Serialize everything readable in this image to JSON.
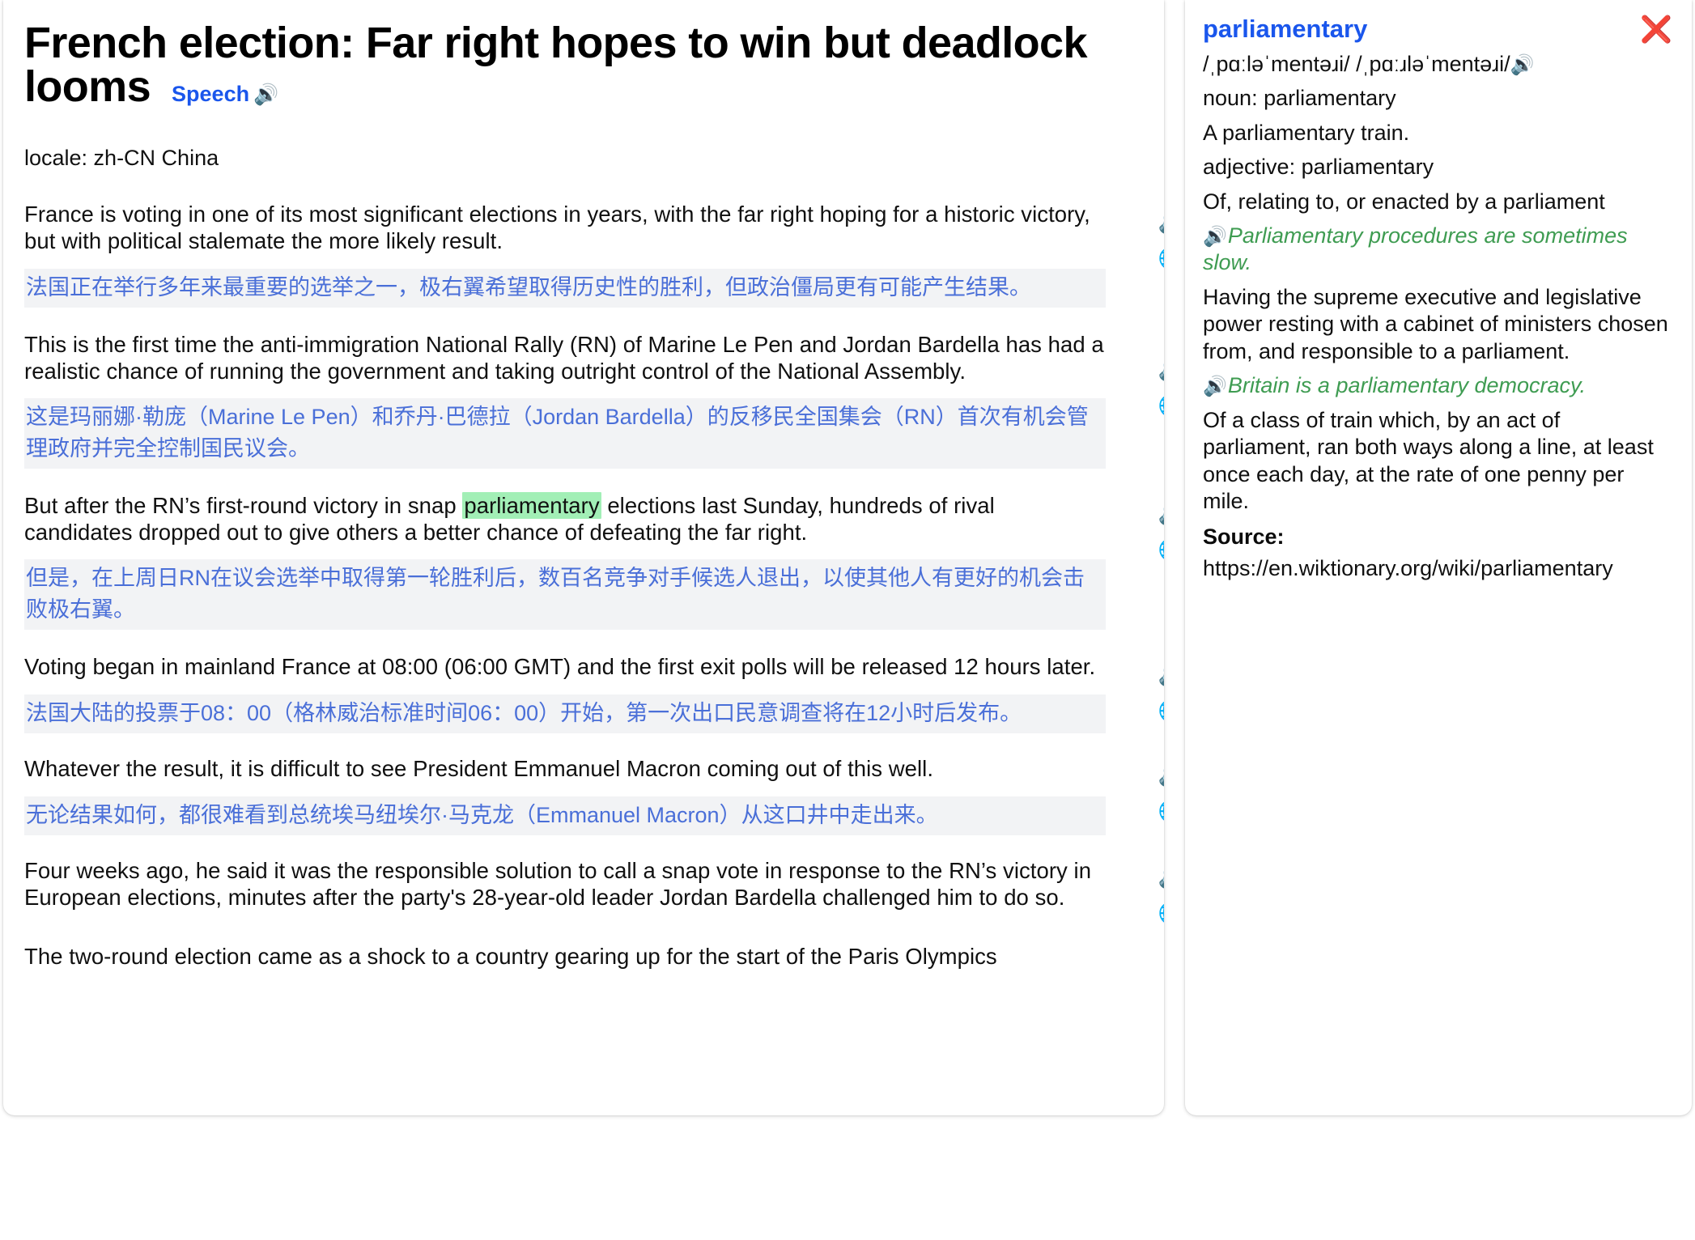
{
  "article": {
    "title": "French election: Far right hopes to win but deadlock looms",
    "speech_label": "Speech",
    "speech_icon": "speaker-icon",
    "locale_line": "locale: zh-CN China",
    "speaker_icon": "🔊",
    "globe_icon": "🌐",
    "highlight_word": "parliamentary",
    "highlight_color": "#a2efb6",
    "paragraphs": [
      {
        "en_before": "France is voting in one of its most significant elections in years, with the far right hoping for a historic victory, but with political stalemate the more likely result.",
        "en_highlight": "",
        "en_after": "",
        "zh": "法国正在举行多年来最重要的选举之一，极右翼希望取得历史性的胜利，但政治僵局更有可能产生结果。"
      },
      {
        "en_before": "This is the first time the anti-immigration National Rally (RN) of Marine Le Pen and Jordan Bardella has had a realistic chance of running the government and taking outright control of the National Assembly.",
        "en_highlight": "",
        "en_after": "",
        "zh": "这是玛丽娜·勒庞（Marine Le Pen）和乔丹·巴德拉（Jordan Bardella）的反移民全国集会（RN）首次有机会管理政府并完全控制国民议会。"
      },
      {
        "en_before": "But after the RN’s first-round victory in snap ",
        "en_highlight": "parliamentary",
        "en_after": " elections last Sunday, hundreds of rival candidates dropped out to give others a better chance of defeating the far right.",
        "zh": "但是，在上周日RN在议会选举中取得第一轮胜利后，数百名竞争对手候选人退出，以使其他人有更好的机会击败极右翼。"
      },
      {
        "en_before": "Voting began in mainland France at 08:00 (06:00 GMT) and the first exit polls will be released 12 hours later.",
        "en_highlight": "",
        "en_after": "",
        "zh": "法国大陆的投票于08：00（格林威治标准时间06：00）开始，第一次出口民意调查将在12小时后发布。"
      },
      {
        "en_before": "Whatever the result, it is difficult to see President Emmanuel Macron coming out of this well.",
        "en_highlight": "",
        "en_after": "",
        "zh": "无论结果如何，都很难看到总统埃马纽埃尔·马克龙（Emmanuel Macron）从这口井中走出来。"
      },
      {
        "en_before": "Four weeks ago, he said it was the responsible solution to call a snap vote in response to the RN’s victory in European elections, minutes after the party's 28-year-old leader Jordan Bardella challenged him to do so.",
        "en_highlight": "",
        "en_after": "",
        "zh": ""
      },
      {
        "en_before": "The two-round election came as a shock to a country gearing up for the start of the Paris Olympics",
        "en_highlight": "",
        "en_after": "",
        "zh": ""
      }
    ]
  },
  "dictionary": {
    "word": "parliamentary",
    "close_icon": "❌",
    "speaker_icon": "🔊",
    "ipa": "/ˌpɑːləˈmentəɹi/  /ˌpɑːɹləˈmentəɹi/",
    "entries": [
      {
        "type": "pos",
        "text": "noun: parliamentary"
      },
      {
        "type": "def",
        "text": "A parliamentary train."
      },
      {
        "type": "pos",
        "text": "adjective: parliamentary"
      },
      {
        "type": "def",
        "text": "Of, relating to, or enacted by a parliament"
      },
      {
        "type": "example",
        "text": "Parliamentary procedures are sometimes slow."
      },
      {
        "type": "def",
        "text": "Having the supreme executive and legislative power resting with a cabinet of ministers chosen from, and responsible to a parliament."
      },
      {
        "type": "example",
        "text": "Britain is a parliamentary democracy."
      },
      {
        "type": "def",
        "text": "Of a class of train which, by an act of parliament, ran both ways along a line, at least once each day, at the rate of one penny per mile."
      }
    ],
    "source_label": "Source:",
    "source_url": "https://en.wiktionary.org/wiki/parliamentary"
  }
}
